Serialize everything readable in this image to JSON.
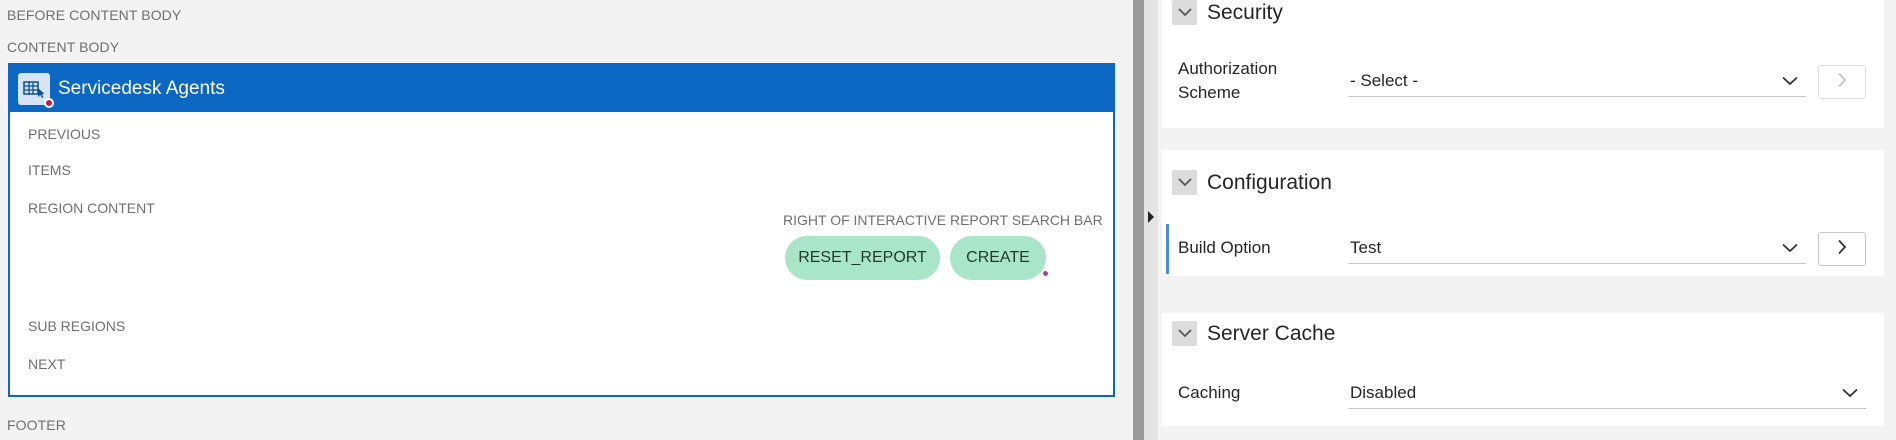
{
  "canvas": {
    "before_content_body": "BEFORE CONTENT BODY",
    "content_body": "CONTENT BODY",
    "footer": "FOOTER",
    "region": {
      "title": "Servicedesk Agents",
      "icon": "interactive-report-icon",
      "positions": {
        "previous": "PREVIOUS",
        "items": "ITEMS",
        "region_content": "REGION CONTENT",
        "sub_regions": "SUB REGIONS",
        "next": "NEXT",
        "right_of_search_bar": "RIGHT OF INTERACTIVE REPORT SEARCH BAR"
      },
      "buttons": {
        "reset_report": "RESET_REPORT",
        "create": "CREATE"
      },
      "colors": {
        "header": "#0b67c1",
        "button": "#a9e6c9"
      }
    }
  },
  "property_editor": {
    "security": {
      "title": "Security",
      "authorization_scheme_label": "Authorization Scheme",
      "authorization_scheme_value": "- Select -"
    },
    "configuration": {
      "title": "Configuration",
      "build_option_label": "Build Option",
      "build_option_value": "Test"
    },
    "server_cache": {
      "title": "Server Cache",
      "caching_label": "Caching",
      "caching_value": "Disabled"
    }
  }
}
